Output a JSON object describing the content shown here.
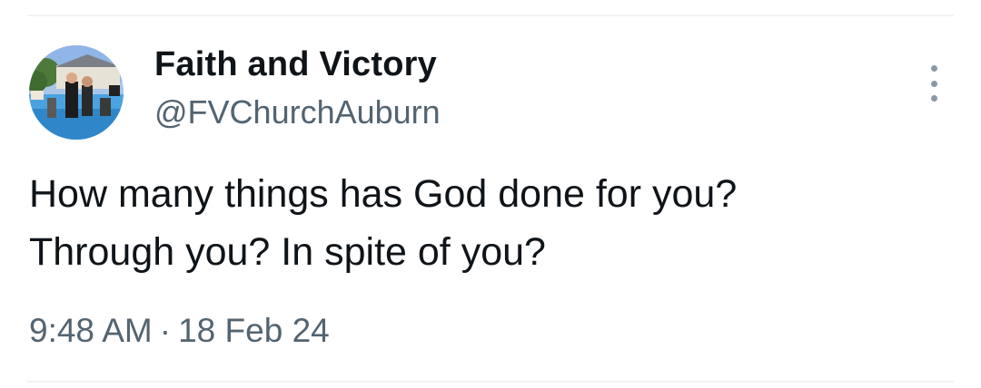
{
  "tweet": {
    "author": {
      "display_name": "Faith and Victory",
      "handle": "@FVChurchAuburn",
      "avatar_icon": "profile-photo"
    },
    "text_lines": [
      "How many things has God done for you?",
      "Through you? In spite of you?"
    ],
    "time": "9:48 AM",
    "separator": "·",
    "date": "18 Feb 24",
    "more_icon": "vertical-ellipsis-icon"
  },
  "colors": {
    "text_primary": "#0f1419",
    "text_secondary": "#536471",
    "divider": "#eff3f4",
    "more_dots": "#8b98a5"
  }
}
